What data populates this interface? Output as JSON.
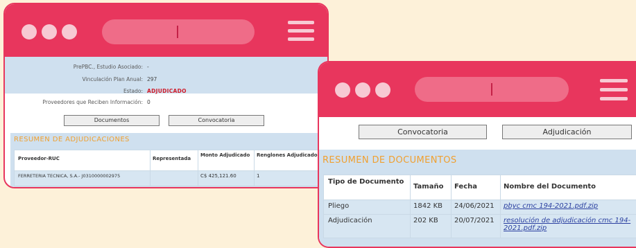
{
  "window1": {
    "info": [
      {
        "label": "PrePBC., Estudio Asociado:",
        "value": "-"
      },
      {
        "label": "Vinculación Plan Anual:",
        "value": "297"
      },
      {
        "label": "Estado:",
        "value": "ADJUDICADO"
      },
      {
        "label": "Proveedores que Reciben Información:",
        "value": "0"
      }
    ],
    "buttons": {
      "documentos": "Documentos",
      "convocatoria": "Convocatoria"
    },
    "section_title": "RESUMEN DE ADJUDICACIONES",
    "table": {
      "headers": [
        "Proveedor-RUC",
        "Representada",
        "Monto Adjudicado",
        "Renglones Adjudicados"
      ],
      "rows": [
        [
          "FERRETERIA TECNICA, S.A.- J0310000002975",
          "",
          "C$ 425,121.60",
          "1"
        ]
      ]
    }
  },
  "window2": {
    "buttons": {
      "convocatoria": "Convocatoria",
      "adjudicacion": "Adjudicación"
    },
    "section_title": "RESUMEN DE DOCUMENTOS",
    "table": {
      "headers": [
        "Tipo de Documento",
        "Tamaño",
        "Fecha",
        "Nombre del Documento"
      ],
      "rows": [
        [
          "Pliego",
          "1842 KB",
          "24/06/2021",
          "pbyc cmc 194-2021.pdf.zip"
        ],
        [
          "Adjudicación",
          "202 KB",
          "20/07/2021",
          "resolución de adjudicación cmc 194-2021.pdf.zip"
        ]
      ]
    }
  },
  "colors": {
    "accent": "#e8365d",
    "panel": "#cfe0ef",
    "section": "#f0a030",
    "background": "#fdf1d9"
  }
}
